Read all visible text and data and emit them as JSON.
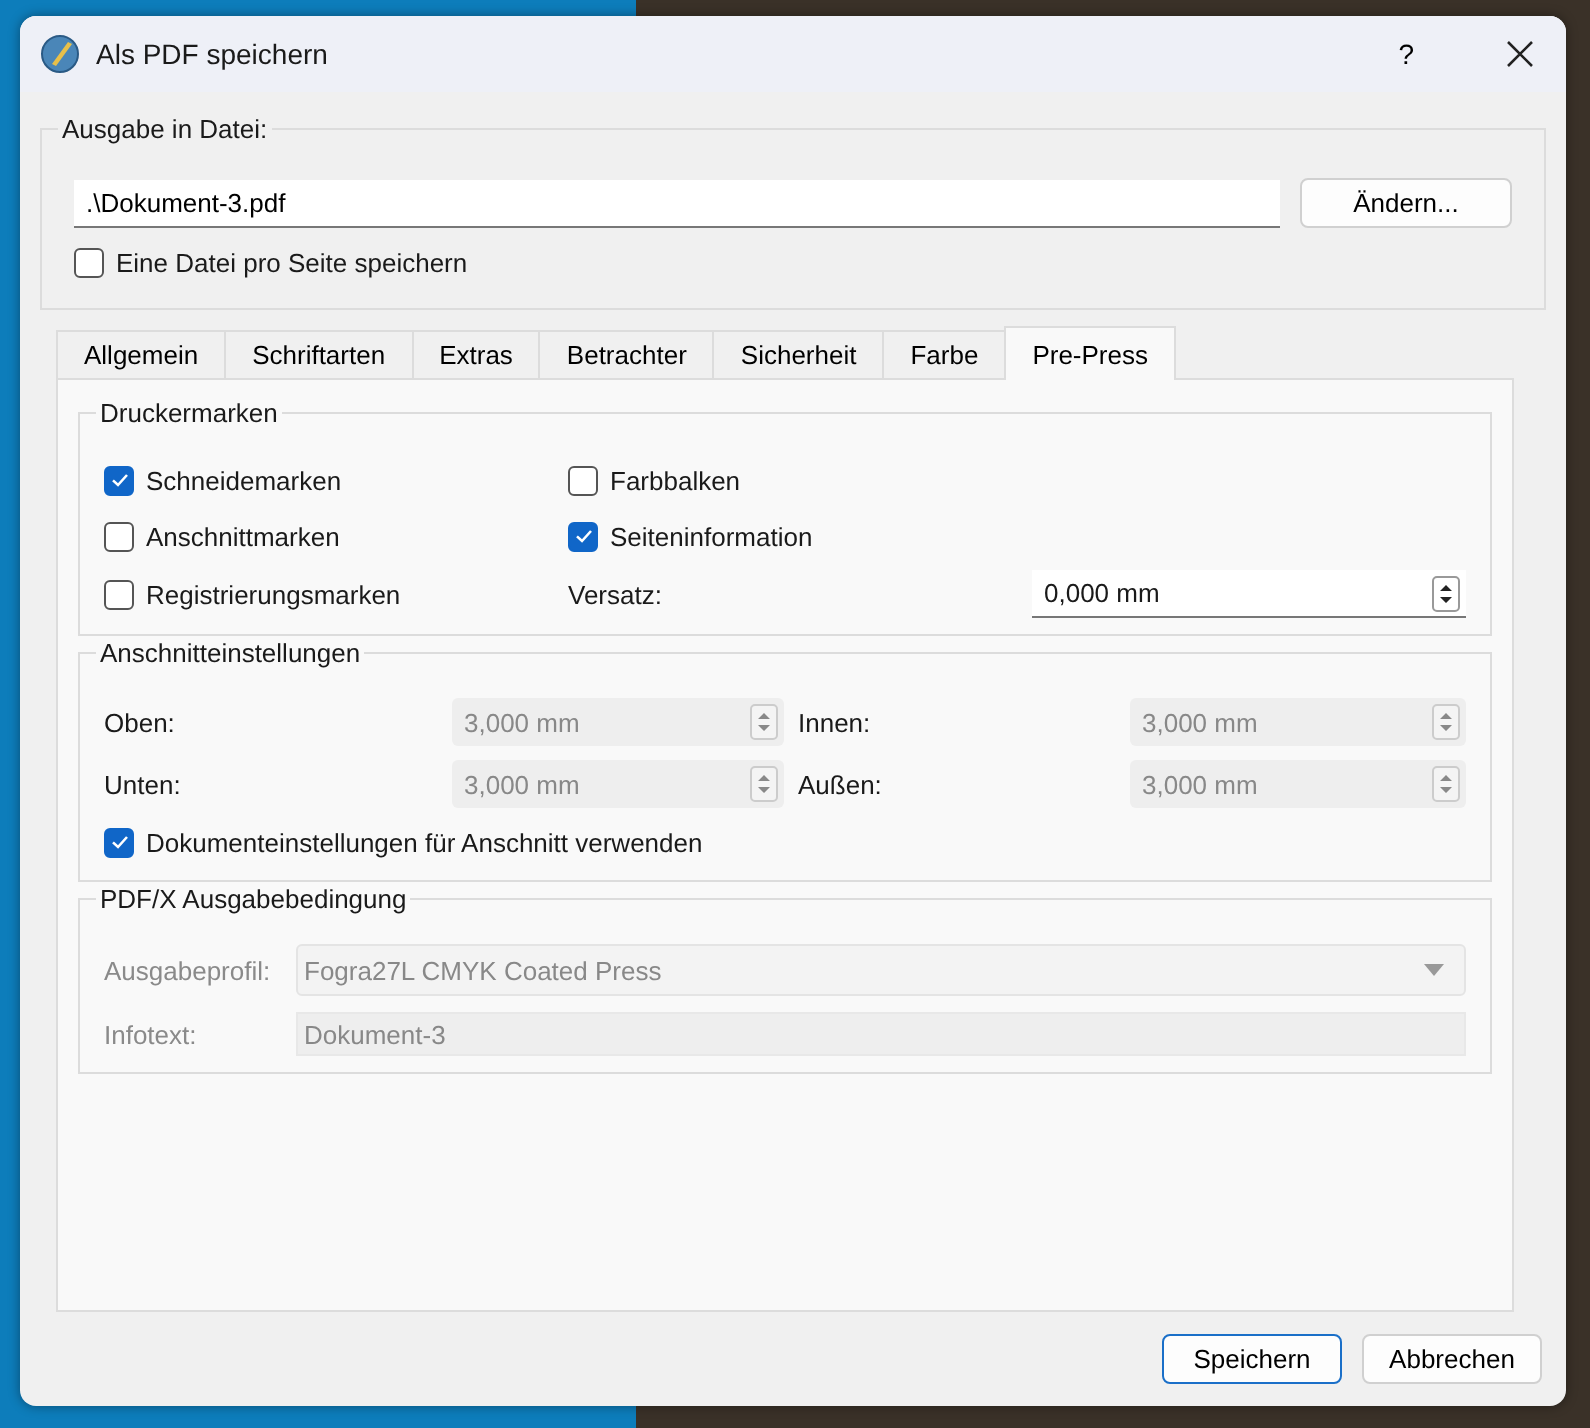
{
  "window": {
    "title": "Als PDF speichern",
    "help": "?"
  },
  "output": {
    "title": "Ausgabe in Datei:",
    "file": ".\\Dokument-3.pdf",
    "change_button": "Ändern...",
    "one_file_per_page": {
      "label": "Eine Datei pro Seite speichern",
      "checked": false
    }
  },
  "tabs": [
    {
      "label": "Allgemein",
      "selected": false
    },
    {
      "label": "Schriftarten",
      "selected": false
    },
    {
      "label": "Extras",
      "selected": false
    },
    {
      "label": "Betrachter",
      "selected": false
    },
    {
      "label": "Sicherheit",
      "selected": false
    },
    {
      "label": "Farbe",
      "selected": false
    },
    {
      "label": "Pre-Press",
      "selected": true
    }
  ],
  "printer_marks": {
    "title": "Druckermarken",
    "checkboxes": [
      {
        "label": "Schneidemarken",
        "checked": true
      },
      {
        "label": "Farbbalken",
        "checked": false
      },
      {
        "label": "Anschnittmarken",
        "checked": false
      },
      {
        "label": "Seiteninformation",
        "checked": true
      },
      {
        "label": "Registrierungsmarken",
        "checked": false
      }
    ],
    "offset": {
      "label": "Versatz:",
      "value": "0,000 mm"
    }
  },
  "bleed": {
    "title": "Anschnitteinstellungen",
    "disabled": true,
    "fields": [
      {
        "label": "Oben:",
        "value": "3,000 mm"
      },
      {
        "label": "Innen:",
        "value": "3,000 mm"
      },
      {
        "label": "Unten:",
        "value": "3,000 mm"
      },
      {
        "label": "Außen:",
        "value": "3,000 mm"
      }
    ],
    "use_document": {
      "label": "Dokumenteinstellungen für Anschnitt verwenden",
      "checked": true
    }
  },
  "pdfx": {
    "title": "PDF/X Ausgabebedingung",
    "disabled": true,
    "profile": {
      "label": "Ausgabeprofil:",
      "value": "Fogra27L CMYK Coated Press"
    },
    "infotext": {
      "label": "Infotext:",
      "value": "Dokument-3"
    }
  },
  "buttons": [
    {
      "label": "Speichern",
      "default": true
    },
    {
      "label": "Abbrechen",
      "default": false
    }
  ]
}
